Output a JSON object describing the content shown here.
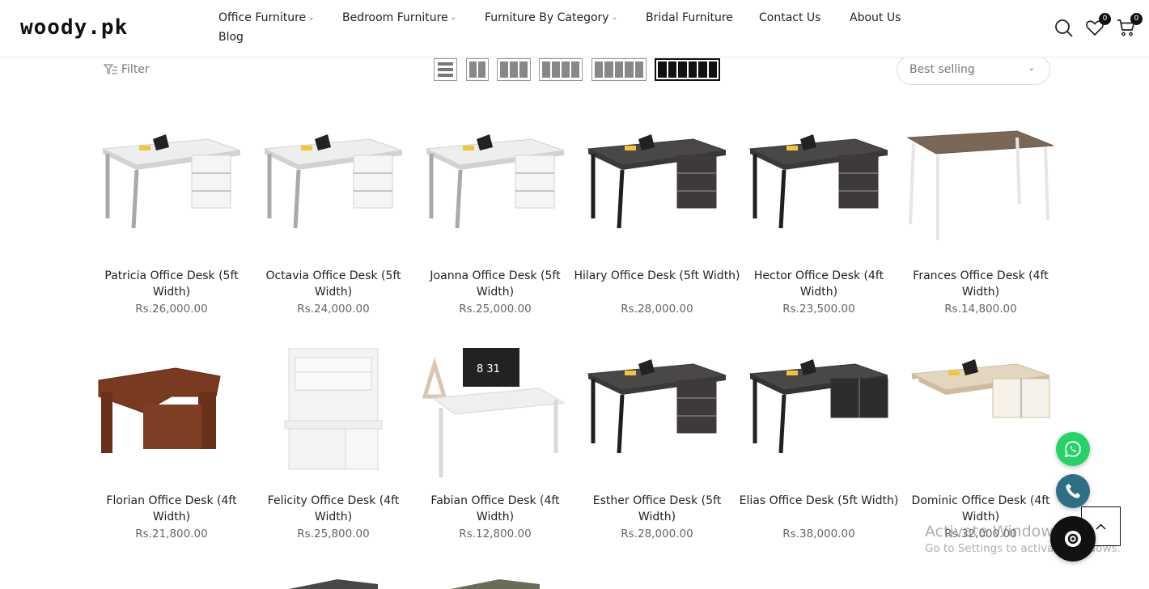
{
  "header": {
    "logo_text": "woody.pk",
    "nav": [
      {
        "label": "Office Furniture",
        "has_dropdown": true
      },
      {
        "label": "Bedroom Furniture",
        "has_dropdown": true
      },
      {
        "label": "Furniture By Category",
        "has_dropdown": true
      },
      {
        "label": "Bridal Furniture",
        "has_dropdown": false
      },
      {
        "label": "Contact Us",
        "has_dropdown": false
      },
      {
        "label": "About Us",
        "has_dropdown": false
      },
      {
        "label": "Blog",
        "has_dropdown": false
      }
    ],
    "wishlist_count": "0",
    "cart_count": "0"
  },
  "toolbar": {
    "filter_label": "Filter",
    "layout_options": [
      "list",
      "2 columns",
      "3 columns",
      "4 columns",
      "5 columns",
      "6 columns"
    ],
    "active_layout": "6 columns",
    "sort_label": "Best selling"
  },
  "products": [
    {
      "title": "Patricia Office Desk (5ft Width)",
      "price": "Rs.26,000.00",
      "style": "white-grey"
    },
    {
      "title": "Octavia Office Desk (5ft Width)",
      "price": "Rs.24,000.00",
      "style": "white-grey"
    },
    {
      "title": "Joanna Office Desk (5ft Width)",
      "price": "Rs.25,000.00",
      "style": "white-grey"
    },
    {
      "title": "Hilary Office Desk (5ft Width)",
      "price": "Rs.28,000.00",
      "style": "dark"
    },
    {
      "title": "Hector Office Desk (4ft Width)",
      "price": "Rs.23,500.00",
      "style": "dark"
    },
    {
      "title": "Frances Office Desk (4ft Width)",
      "price": "Rs.14,800.00",
      "style": "walnut-white"
    },
    {
      "title": "Florian Office Desk (4ft Width)",
      "price": "Rs.21,800.00",
      "style": "mahogany"
    },
    {
      "title": "Felicity Office Desk (4ft Width)",
      "price": "Rs.25,800.00",
      "style": "white-hutch"
    },
    {
      "title": "Fabian Office Desk (4ft Width)",
      "price": "Rs.12,800.00",
      "style": "white-simple"
    },
    {
      "title": "Esther Office Desk (5ft Width)",
      "price": "Rs.28,000.00",
      "style": "dark"
    },
    {
      "title": "Elias Office Desk (5ft Width)",
      "price": "Rs.38,000.00",
      "style": "dark-l"
    },
    {
      "title": "Dominic Office Desk (4ft Width)",
      "price": "Rs.32,000.00",
      "style": "oak-l"
    }
  ],
  "watermark": {
    "line1": "Activate Windows",
    "line2": "Go to Settings to activate Windows."
  },
  "colors": {
    "whatsapp": "#25d366",
    "phone": "#2f6f86",
    "chat": "#111111"
  }
}
